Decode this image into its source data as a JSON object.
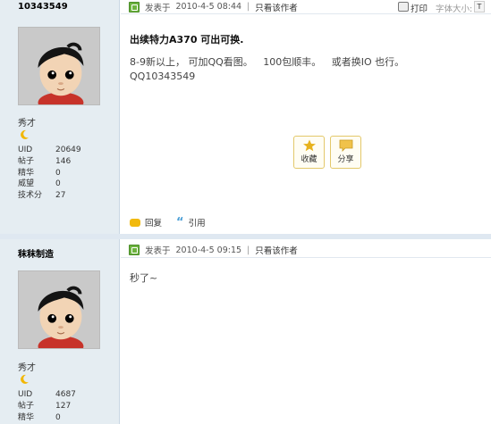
{
  "posts": [
    {
      "username": "10343549",
      "rank": "秀才",
      "stats": [
        {
          "label": "UID",
          "value": "20649"
        },
        {
          "label": "帖子",
          "value": "146"
        },
        {
          "label": "精华",
          "value": "0"
        },
        {
          "label": "威望",
          "value": "0"
        },
        {
          "label": "技术分",
          "value": "27"
        }
      ],
      "posted_label": "发表于",
      "posted_time": "2010-4-5 08:44",
      "only_author": "只看该作者",
      "print": "打印",
      "font_size": "字体大小:",
      "font_size_btn": "T",
      "title": "出续特力A370 可出可换.",
      "body_lines": [
        "8-9新以上， 可加QQ看图。",
        "100包顺丰。",
        "或者换IO 也行。",
        "QQ10343549"
      ],
      "fav": "收藏",
      "share": "分享",
      "reply": "回复",
      "quote": "引用"
    },
    {
      "username": "秣秣制造",
      "rank": "秀才",
      "stats": [
        {
          "label": "UID",
          "value": "4687"
        },
        {
          "label": "帖子",
          "value": "127"
        },
        {
          "label": "精华",
          "value": "0"
        }
      ],
      "posted_label": "发表于",
      "posted_time": "2010-4-5 09:15",
      "only_author": "只看该作者",
      "body": "秒了~"
    }
  ],
  "icons": {
    "post": "post-icon",
    "rank": "moon-icon",
    "print": "print-icon",
    "fav": "star-icon",
    "share": "share-icon",
    "reply": "reply-icon",
    "quote": "quote-icon"
  },
  "colors": {
    "sidebar_bg": "#e5edf2",
    "separator": "#dfe8f1",
    "accent_gold": "#e3c86a"
  }
}
